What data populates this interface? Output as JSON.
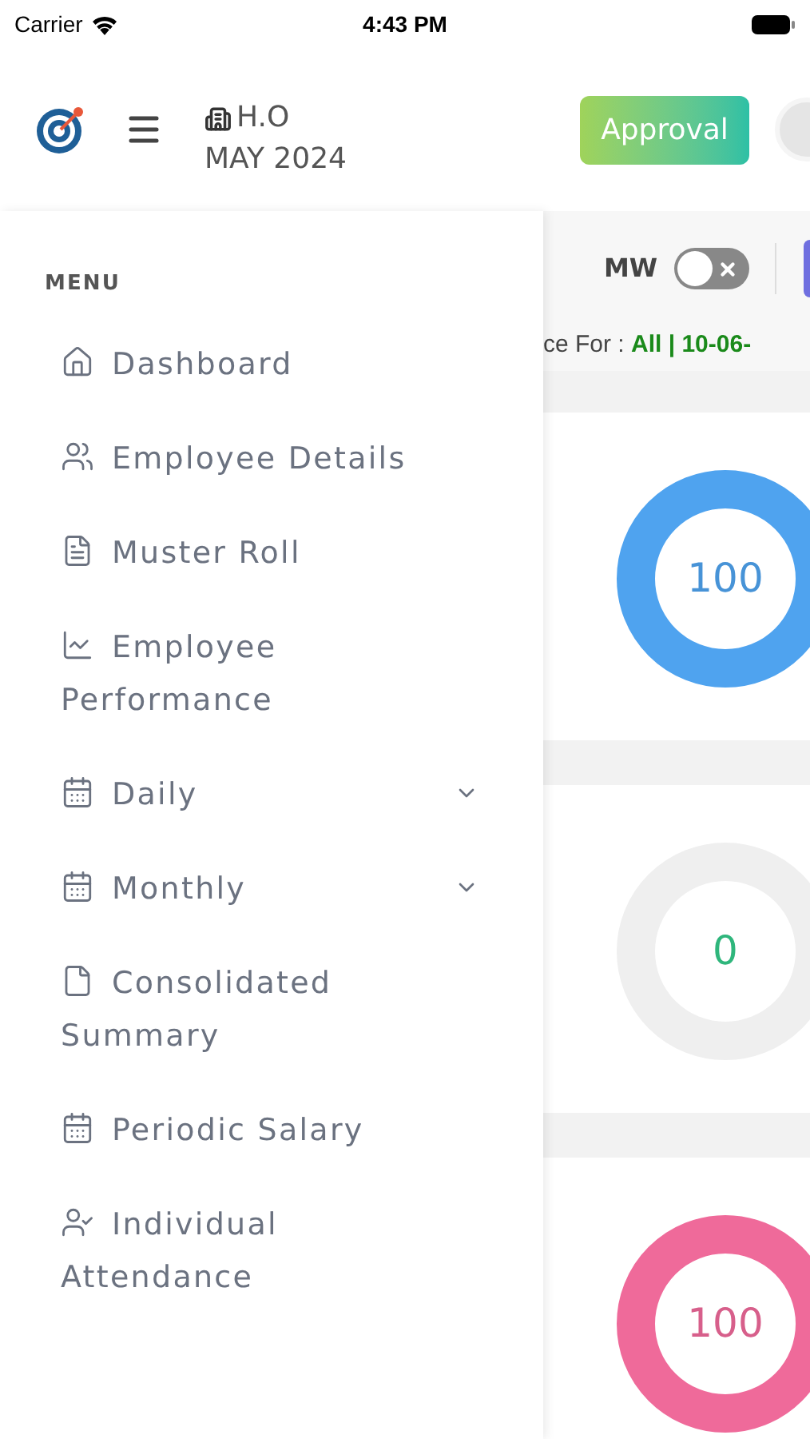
{
  "status_bar": {
    "carrier": "Carrier",
    "time": "4:43 PM"
  },
  "header": {
    "branch": "H.O",
    "period": "MAY 2024",
    "approval_button": "Approval"
  },
  "toolbar": {
    "toggle_label": "MW",
    "toggle_on": false,
    "filter_prefix": "ce For : ",
    "filter_value": "All | 10-06-"
  },
  "donuts": [
    {
      "value": "100",
      "color": "#4fa3ef",
      "kind": "filled"
    },
    {
      "value": "0",
      "color": "#efefef",
      "kind": "empty"
    },
    {
      "value": "100",
      "color": "#ef6a9a",
      "kind": "filled"
    }
  ],
  "menu": {
    "heading": "MENU",
    "items": [
      {
        "label": "Dashboard",
        "kind": "link"
      },
      {
        "label": "Employee Details",
        "kind": "link"
      },
      {
        "label": "Muster Roll",
        "kind": "link"
      },
      {
        "label": "Employee Performance",
        "kind": "link"
      },
      {
        "label": "Daily",
        "kind": "group",
        "expanded": false
      },
      {
        "label": "Monthly",
        "kind": "group",
        "expanded": false
      },
      {
        "label": "Consolidated Summary",
        "kind": "link"
      },
      {
        "label": "Periodic Salary",
        "kind": "link"
      },
      {
        "label": "Individual Attendance",
        "kind": "link"
      }
    ]
  }
}
